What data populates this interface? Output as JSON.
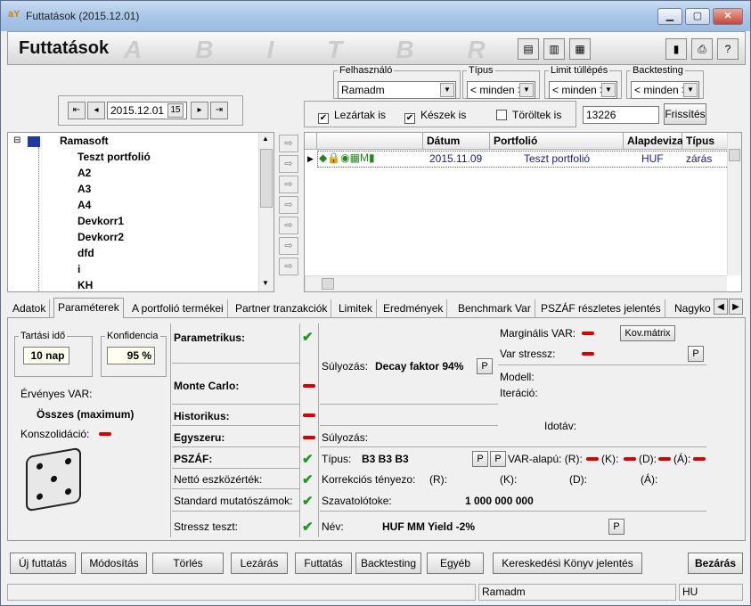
{
  "window": {
    "title": "Futtatások (2015.12.01)",
    "app_letter": "aY"
  },
  "header": {
    "title": "Futtatások",
    "watermark": "ABITBR"
  },
  "filters": {
    "date": "2015.12.01",
    "user_label": "Felhasználó",
    "user_value": "Ramadm",
    "type_label": "Típus",
    "type_value": "< minden >",
    "limit_label": "Limit túllépés",
    "limit_value": "< minden >",
    "backtest_label": "Backtesting",
    "backtest_value": "< minden >",
    "closed_label": "Lezártak is",
    "ready_label": "Készek is",
    "deleted_label": "Töröltek is",
    "id_value": "13226",
    "refresh_label": "Frissítés"
  },
  "tree": {
    "root": "Ramasoft",
    "items": [
      "Teszt portfolió",
      "A2",
      "A3",
      "A4",
      "Devkorr1",
      "Devkorr2",
      "dfd",
      "i",
      "KH"
    ]
  },
  "grid": {
    "headers": [
      "Dátum",
      "Portfolió",
      "Alapdeviza",
      "Típus"
    ],
    "row": {
      "date": "2015.11.09",
      "portfolio": "Teszt portfolió",
      "currency": "HUF",
      "type": "zárás"
    }
  },
  "tabs": [
    "Adatok",
    "Paraméterek",
    "A portfolió termékei",
    "Partner tranzakciók",
    "Limitek",
    "Eredmények",
    "Benchmark Var",
    "PSZÁF részletes jelentés",
    "Nagyko"
  ],
  "params": {
    "holding_label": "Tartási idő",
    "holding_value": "10 nap",
    "conf_label": "Konfidencia",
    "conf_value": "95 %",
    "valid_var_label": "Érvényes VAR:",
    "valid_var_value": "Összes (maximum)",
    "consolidation_label": "Konszolidáció:",
    "parametric": "Parametrikus:",
    "montecarlo": "Monte Carlo:",
    "historic": "Historikus:",
    "simple": "Egyszeru:",
    "pszaf": "PSZÁF:",
    "net_assets": "Nettó eszközérték:",
    "std_metrics": "Standard mutatószámok:",
    "stress_test": "Stressz teszt:",
    "weighting_label": "Súlyozás:",
    "weighting_value": "Decay faktor 94%",
    "marginal_var": "Marginális VAR:",
    "var_stress": "Var stressz:",
    "kov_matrix": "Kov.mátrix",
    "model": "Modell:",
    "iteration": "Iteráció:",
    "timeframe": "Idotáv:",
    "weighting2_label": "Súlyozás:",
    "type_label": "Típus:",
    "type_value": "B3 B3 B3",
    "var_based": "VAR-alapú: (R):",
    "k_label": "(K):",
    "d_label": "(D):",
    "a_label": "(Á):",
    "corr_label": "Korrekciós tényezo:",
    "r2": "(R):",
    "k2": "(K):",
    "d2": "(D):",
    "a2": "(Á):",
    "multiplier_label": "Szavatolótoke:",
    "multiplier_value": "1 000 000 000",
    "name_label": "Név:",
    "name_value": "HUF MM Yield -2%",
    "p": "P"
  },
  "buttons": [
    "Új futtatás",
    "Módosítás",
    "Törlés",
    "Lezárás",
    "Futtatás",
    "Backtesting",
    "Egyéb",
    "Kereskedési Könyv jelentés"
  ],
  "close_label": "Bezárás",
  "status": {
    "user": "Ramadm",
    "locale": "HU"
  },
  "colors": {
    "accent": "#1a1a8c",
    "ok": "#1e9a1e",
    "error": "#dd0000"
  }
}
